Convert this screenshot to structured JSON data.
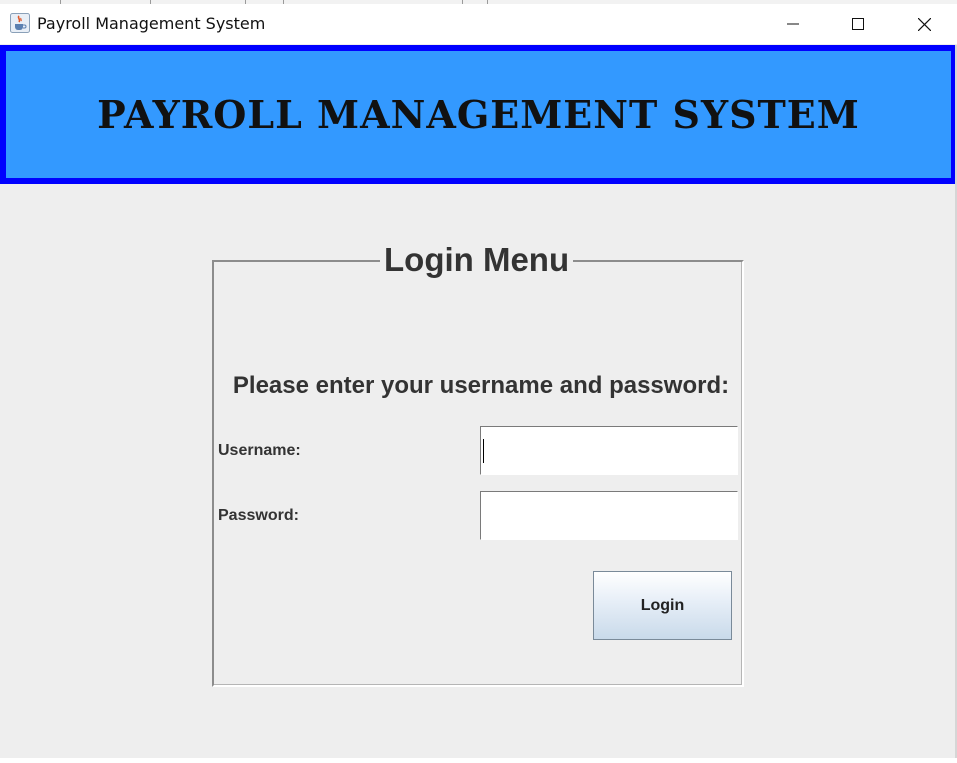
{
  "window": {
    "title": "Payroll Management System",
    "icon": "java-cup-icon",
    "controls": [
      "minimize-icon",
      "maximize-icon",
      "close-icon"
    ]
  },
  "header": {
    "title": "PAYROLL MANAGEMENT SYSTEM",
    "background_color": "#3399ff",
    "border_color": "#0000ff"
  },
  "login": {
    "legend": "Login Menu",
    "prompt": "Please enter your username and password:",
    "username_label": "Username:",
    "username_value": "",
    "password_label": "Password:",
    "password_value": "",
    "login_button": "Login"
  }
}
